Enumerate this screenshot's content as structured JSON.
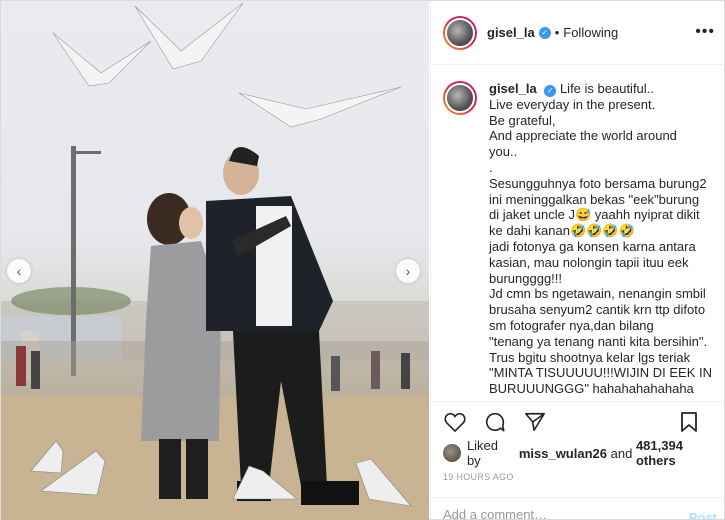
{
  "post": {
    "username": "gisel_la",
    "follow_status": "Following",
    "dot": "•",
    "more_icon": "more-horizontal-icon",
    "nav_prev": "‹",
    "nav_next": "›"
  },
  "caption": {
    "username": "gisel_la",
    "lines": [
      "Life is beautiful..",
      "Live everyday in the present.",
      "Be grateful,",
      "And appreciate the world around",
      "you..",
      ".",
      "Sesungguhnya foto bersama burung2",
      "ini meninggalkan bekas \"eek\"burung",
      "di jaket uncle J😅 yaahh nyiprat dikit",
      "ke dahi kanan🤣🤣🤣🤣",
      "jadi fotonya ga konsen karna antara",
      "kasian, mau nolongin tapii ituu eek",
      "burungggg!!!",
      "Jd cmn bs ngetawain, nenangin smbil",
      "brusaha senyum2 cantik krn ttp difoto",
      "sm fotografer nya,dan bilang",
      "\"tenang ya tenang nanti kita bersihin\".",
      "Trus bgitu shootnya kelar lgs teriak",
      "\"MINTA TISUUUUU!!!WIJIN DI EEK IN",
      "BURUUUNGGG\" hahahahahahaha"
    ]
  },
  "likes": {
    "prefix": "Liked by",
    "user": "miss_wulan26",
    "middle": "and",
    "count": "481,394 others"
  },
  "timestamp": "19 HOURS AGO",
  "comment": {
    "placeholder": "Add a comment…",
    "post_label": "Post"
  },
  "colors": {
    "verified": "#3897f0",
    "post_disabled": "#b2dffc"
  }
}
